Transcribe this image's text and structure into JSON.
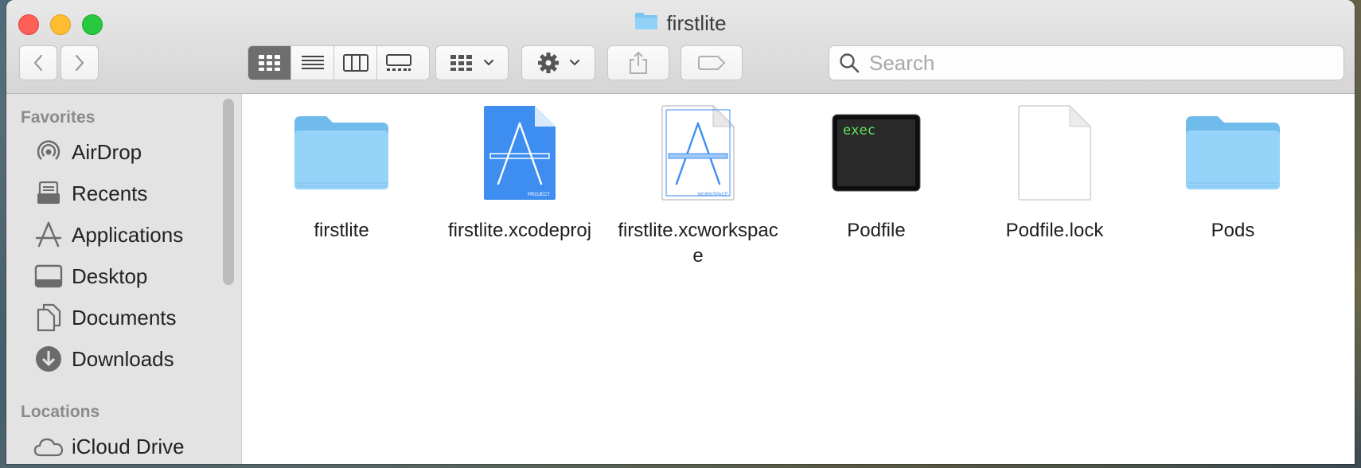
{
  "window": {
    "title": "firstlite"
  },
  "toolbar": {
    "search_placeholder": "Search"
  },
  "sidebar": {
    "favorites_header": "Favorites",
    "favorites": [
      {
        "label": "AirDrop",
        "icon": "airdrop-icon"
      },
      {
        "label": "Recents",
        "icon": "recents-icon"
      },
      {
        "label": "Applications",
        "icon": "applications-icon"
      },
      {
        "label": "Desktop",
        "icon": "desktop-icon"
      },
      {
        "label": "Documents",
        "icon": "documents-icon"
      },
      {
        "label": "Downloads",
        "icon": "downloads-icon"
      }
    ],
    "locations_header": "Locations",
    "locations": [
      {
        "label": "iCloud Drive",
        "icon": "icloud-icon"
      }
    ]
  },
  "files": [
    {
      "name": "firstlite",
      "kind": "folder"
    },
    {
      "name": "firstlite.xcodeproj",
      "kind": "xcodeproj",
      "badge": "PROJECT"
    },
    {
      "name": "firstlite.xcworkspace",
      "kind": "xcworkspace",
      "badge": "WORKSPACE"
    },
    {
      "name": "Podfile",
      "kind": "exec",
      "badge": "exec"
    },
    {
      "name": "Podfile.lock",
      "kind": "document"
    },
    {
      "name": "Pods",
      "kind": "folder"
    }
  ],
  "colors": {
    "folder": "#8fd0f7",
    "xcode_blue": "#3d8ef0",
    "exec_green": "#5ee35e"
  }
}
